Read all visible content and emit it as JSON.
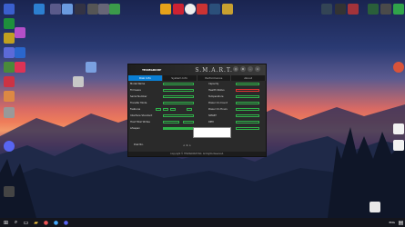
{
  "app": {
    "logo": "TEAMGROUP",
    "title": "S.M.A.R.T.",
    "tabs": [
      {
        "label": "Disk Info",
        "active": true
      },
      {
        "label": "System Info",
        "active": false
      },
      {
        "label": "Performance",
        "active": false
      },
      {
        "label": "About",
        "active": false
      }
    ],
    "left_labels": [
      "Model Name",
      "Firmware",
      "Serial Number",
      "Transfer Mode",
      "Features",
      "Interface Standard",
      "Host Total Writes",
      "Lifespan"
    ],
    "right_labels": [
      "Capacity",
      "Health Status",
      "Temperature",
      "Power On Count",
      "Power On Hours",
      "SMART",
      "RPM",
      "Drive Letter"
    ],
    "footer_label": "Disk No.",
    "pager": "< 1 >",
    "bottom_text": "Copyright © TEAMGROUP INC. All Rights Reserved."
  },
  "taskbar": {
    "search_icon": "search-icon",
    "right_text": "ENG"
  },
  "colors": {
    "accent": "#0a7fd4",
    "ok": "#2fb34a",
    "warn": "#d33333"
  }
}
